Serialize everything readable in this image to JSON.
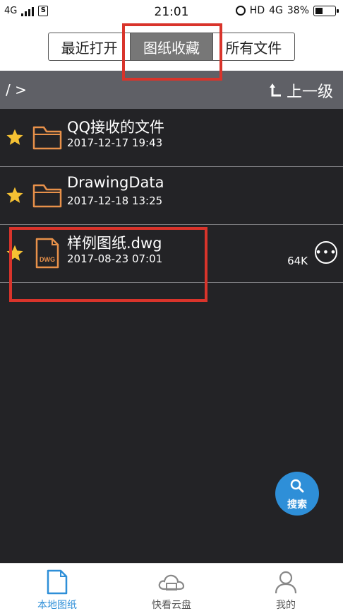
{
  "statusbar": {
    "network_left": "4G",
    "sim_icon": "S",
    "time": "21:01",
    "hd": "HD",
    "network_right": "4G",
    "battery": "38%",
    "battery_level": 0.38
  },
  "tabs": [
    {
      "label": "最近打开",
      "active": false
    },
    {
      "label": "图纸收藏",
      "active": true
    },
    {
      "label": "所有文件",
      "active": false
    }
  ],
  "pathbar": {
    "path": "/ >",
    "up_label": "上一级",
    "up_icon": "return-up-arrow-icon"
  },
  "files": [
    {
      "name": "QQ接收的文件",
      "date": "2017-12-17 19:43",
      "type": "folder",
      "starred": true,
      "size": ""
    },
    {
      "name": "DrawingData",
      "date": "2017-12-18 13:25",
      "type": "folder",
      "starred": true,
      "size": ""
    },
    {
      "name": "样例图纸.dwg",
      "date": "2017-08-23 07:01",
      "type": "dwg",
      "starred": true,
      "size": "64K",
      "file_badge": "DWG"
    }
  ],
  "fab": {
    "label": "搜索",
    "icon": "search-icon"
  },
  "bottom_nav": [
    {
      "label": "本地图纸",
      "icon": "document-icon",
      "active": true
    },
    {
      "label": "快看云盘",
      "icon": "cloud-icon",
      "active": false
    },
    {
      "label": "我的",
      "icon": "user-icon",
      "active": false
    }
  ],
  "colors": {
    "accent": "#2e8fd8",
    "background": "#232326",
    "star": "#f5c133",
    "folder": "#e8914a",
    "highlight": "#d9342b",
    "active_tab": "#777777"
  }
}
